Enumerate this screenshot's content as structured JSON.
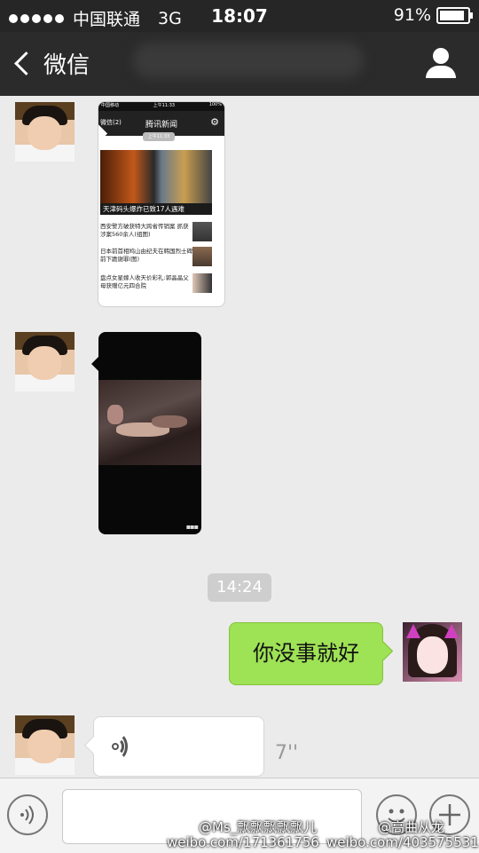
{
  "status_bar": {
    "carrier": "中国联通",
    "network": "3G",
    "time": "18:07",
    "battery": "91%"
  },
  "nav": {
    "back_label": "微信",
    "back_icon": "chevron-left-icon",
    "profile_icon": "person-icon"
  },
  "messages": {
    "shared_screenshot": {
      "status_carrier": "中国移动",
      "status_time": "上午11:33",
      "status_battery": "100%",
      "nav_back": "微信(2)",
      "nav_title": "腾讯新闻",
      "time_badge": "上午11:33",
      "headline": "天津码头爆炸已致17人遇难",
      "items": [
        "西安警方破获特大跨省传销案 抓获涉案560余人(组图)",
        "日本前首相鸠山由纪夫在韩国烈士碑前下跪谢罪(图)",
        "盘点女星嫁人收天价彩礼:郭晶晶父母获赠亿元四合院"
      ]
    },
    "video": {
      "more_icon": "grid-dots-icon"
    },
    "time_separator": "14:24",
    "sent_text": "你没事就好",
    "voice": {
      "duration": "7''",
      "icon": "voice-wave-icon"
    }
  },
  "input_bar": {
    "voice_button_icon": "voice-icon",
    "emoji_button_icon": "smiley-icon",
    "plus_button_icon": "plus-icon"
  },
  "watermarks": {
    "handle_1": "@Ms_飘飘飘飘飘儿",
    "url_1": "weibo.com/171361756",
    "handle_2": "@高曲从龙",
    "url_2": "weibo.com/403575531"
  },
  "colors": {
    "status_bg": "#262626",
    "nav_bg": "#2b2b2b",
    "chat_bg": "#ebebeb",
    "sent_bubble": "#9ee255"
  }
}
